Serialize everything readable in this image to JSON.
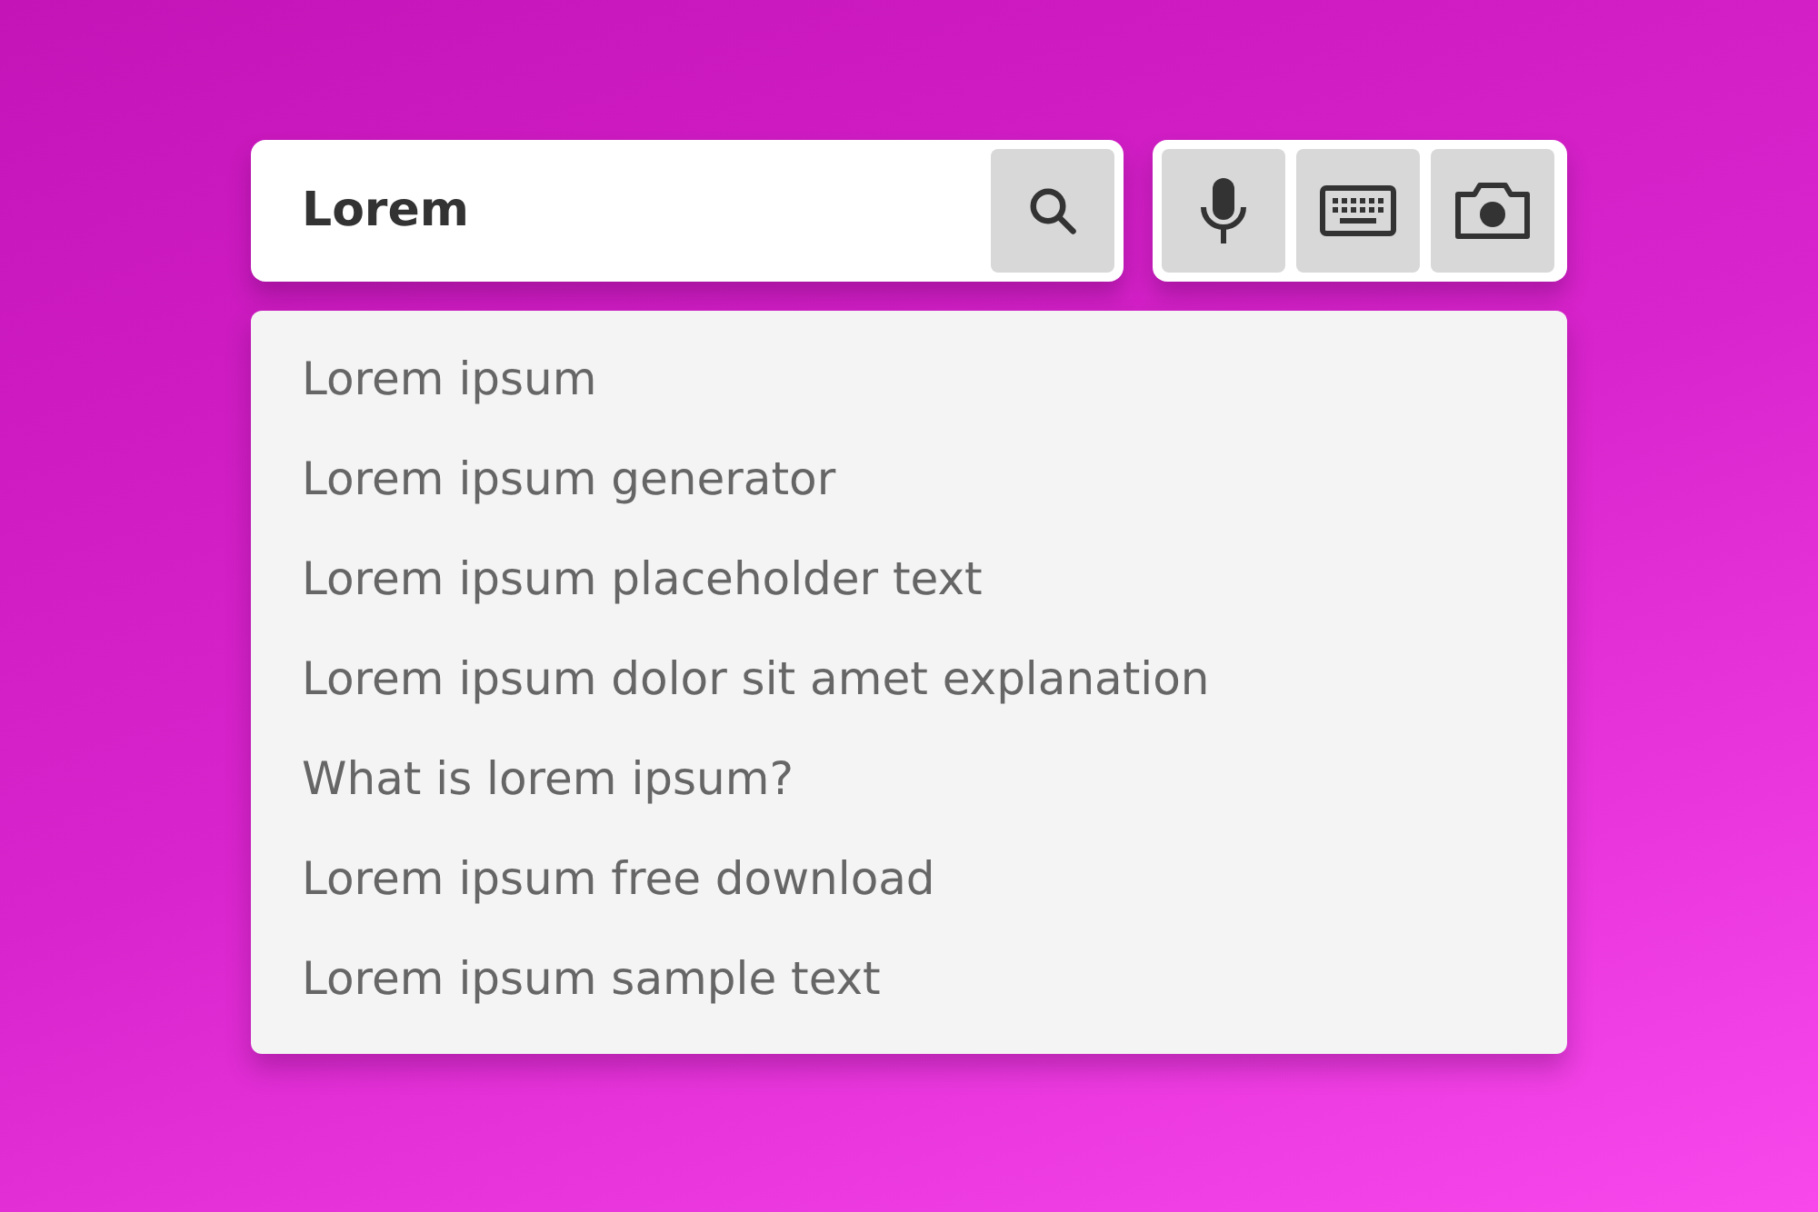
{
  "search": {
    "value": "Lorem"
  },
  "suggestions": [
    "Lorem ipsum",
    "Lorem ipsum generator",
    "Lorem ipsum placeholder text",
    "Lorem ipsum dolor sit amet explanation",
    "What is lorem ipsum?",
    "Lorem ipsum free download",
    "Lorem ipsum sample text"
  ]
}
